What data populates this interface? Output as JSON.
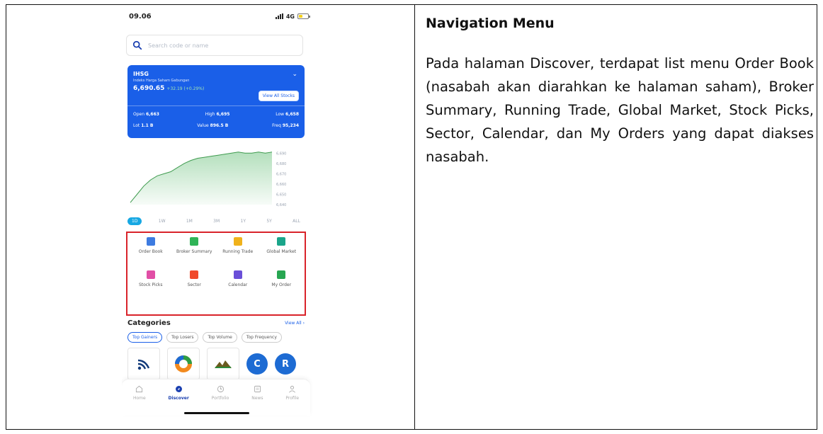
{
  "phone": {
    "status": {
      "time": "09.06",
      "network": "4G"
    },
    "search": {
      "placeholder": "Search code or name"
    },
    "ihsg": {
      "title": "IHSG",
      "subtitle": "Indeks Harga Saham Gabungan",
      "value": "6,690.65",
      "change": "+32.19 (+0.29%)",
      "view_all": "View All Stocks",
      "open_label": "Open",
      "open_value": "6,663",
      "high_label": "High",
      "high_value": "6,695",
      "low_label": "Low",
      "low_value": "6,658",
      "lot_label": "Lot",
      "lot_value": "1.1 B",
      "value_label": "Value",
      "value_value": "896.5 B",
      "freq_label": "Freq",
      "freq_value": "95,234"
    },
    "chart_data": {
      "type": "area",
      "y_ticks": [
        "6,690",
        "6,680",
        "6,670",
        "6,660",
        "6,650",
        "6,640"
      ],
      "ylim": [
        6640,
        6695
      ],
      "values": [
        6642,
        6650,
        6658,
        6664,
        6668,
        6670,
        6672,
        6676,
        6680,
        6683,
        6685,
        6686,
        6687,
        6688,
        6689,
        6690,
        6691,
        6690,
        6690,
        6691,
        6690,
        6691
      ],
      "color": "#58b96b"
    },
    "ranges": [
      "1D",
      "1W",
      "1M",
      "3M",
      "1Y",
      "5Y",
      "ALL"
    ],
    "menu": [
      {
        "label": "Order Book",
        "icon": "order-book-icon",
        "color": "#3d7be0"
      },
      {
        "label": "Broker Summary",
        "icon": "broker-summary-icon",
        "color": "#2fb457"
      },
      {
        "label": "Running Trade",
        "icon": "running-trade-icon",
        "color": "#f0b21b"
      },
      {
        "label": "Global Market",
        "icon": "global-market-icon",
        "color": "#1aa58a"
      },
      {
        "label": "Stock Picks",
        "icon": "stock-picks-icon",
        "color": "#e14fa6"
      },
      {
        "label": "Sector",
        "icon": "sector-icon",
        "color": "#f04a2b"
      },
      {
        "label": "Calendar",
        "icon": "calendar-icon",
        "color": "#6a4fd8"
      },
      {
        "label": "My Order",
        "icon": "my-order-icon",
        "color": "#27a651"
      }
    ],
    "categories": {
      "title": "Categories",
      "view_all": "View All",
      "chips": [
        "Top Gainers",
        "Top Losers",
        "Top Volume",
        "Top Frequency"
      ]
    },
    "logos": [
      {
        "icon": "stock-logo-1"
      },
      {
        "icon": "stock-logo-2"
      },
      {
        "icon": "stock-logo-3"
      },
      {
        "letter": "C",
        "icon": "stock-logo-c"
      },
      {
        "letter": "R",
        "icon": "stock-logo-r"
      }
    ],
    "nav": [
      {
        "label": "Home",
        "icon": "home-icon"
      },
      {
        "label": "Discover",
        "icon": "discover-icon",
        "active": true
      },
      {
        "label": "Portfolio",
        "icon": "portfolio-icon"
      },
      {
        "label": "News",
        "icon": "news-icon"
      },
      {
        "label": "Profile",
        "icon": "profile-icon"
      }
    ]
  },
  "doc": {
    "heading": "Navigation Menu",
    "paragraph": "Pada halaman Discover, terdapat list menu Order Book (nasabah akan diarahkan ke halaman saham), Broker Summary, Running Trade, Global Market, Stock Picks, Sector, Calendar, dan My Orders yang dapat diakses nasabah."
  }
}
